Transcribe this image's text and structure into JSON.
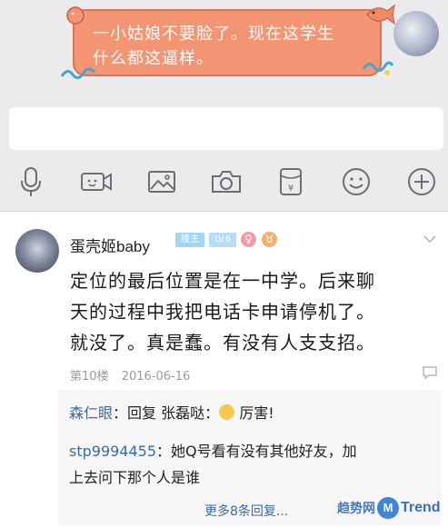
{
  "chat": {
    "bubble_lines": [
      "一小姑娘不要脸了。现在这学生",
      "什么都这逼样。"
    ],
    "input_placeholder": ""
  },
  "toolbar": {
    "icons": [
      "microphone-icon",
      "video-icon",
      "image-icon",
      "camera-icon",
      "red-packet-icon",
      "emoji-icon",
      "plus-icon"
    ]
  },
  "comment": {
    "username": "蛋壳姬baby",
    "badges": {
      "host": "楼主",
      "level": "LV.6",
      "gender": "♀",
      "zodiac": "♉"
    },
    "body_lines": [
      "定位的最后位置是在一中学。后来聊",
      "天的过程中我把电话卡申请停机了。",
      "就没了。真是蠢。有没有人支支招。"
    ],
    "floor": "第10楼",
    "date": "2016-06-16"
  },
  "replies": [
    {
      "author": "森仁眼",
      "sep": "：回复",
      "target": "张磊哒",
      "sep2": "：",
      "text": "厉害!"
    },
    {
      "author": "stp9994455",
      "sep": "：",
      "text_line1": "她Q号看有没有其他好友，加",
      "text_line2": "上去问下那个人是谁"
    }
  ],
  "more_replies": "更多8条回复...",
  "watermark": {
    "prefix": "趋势网",
    "circle": "M",
    "suffix": "Trend"
  },
  "colors": {
    "bubble": "#f39473",
    "link": "#3c6aa8",
    "panel": "#ebebed"
  }
}
